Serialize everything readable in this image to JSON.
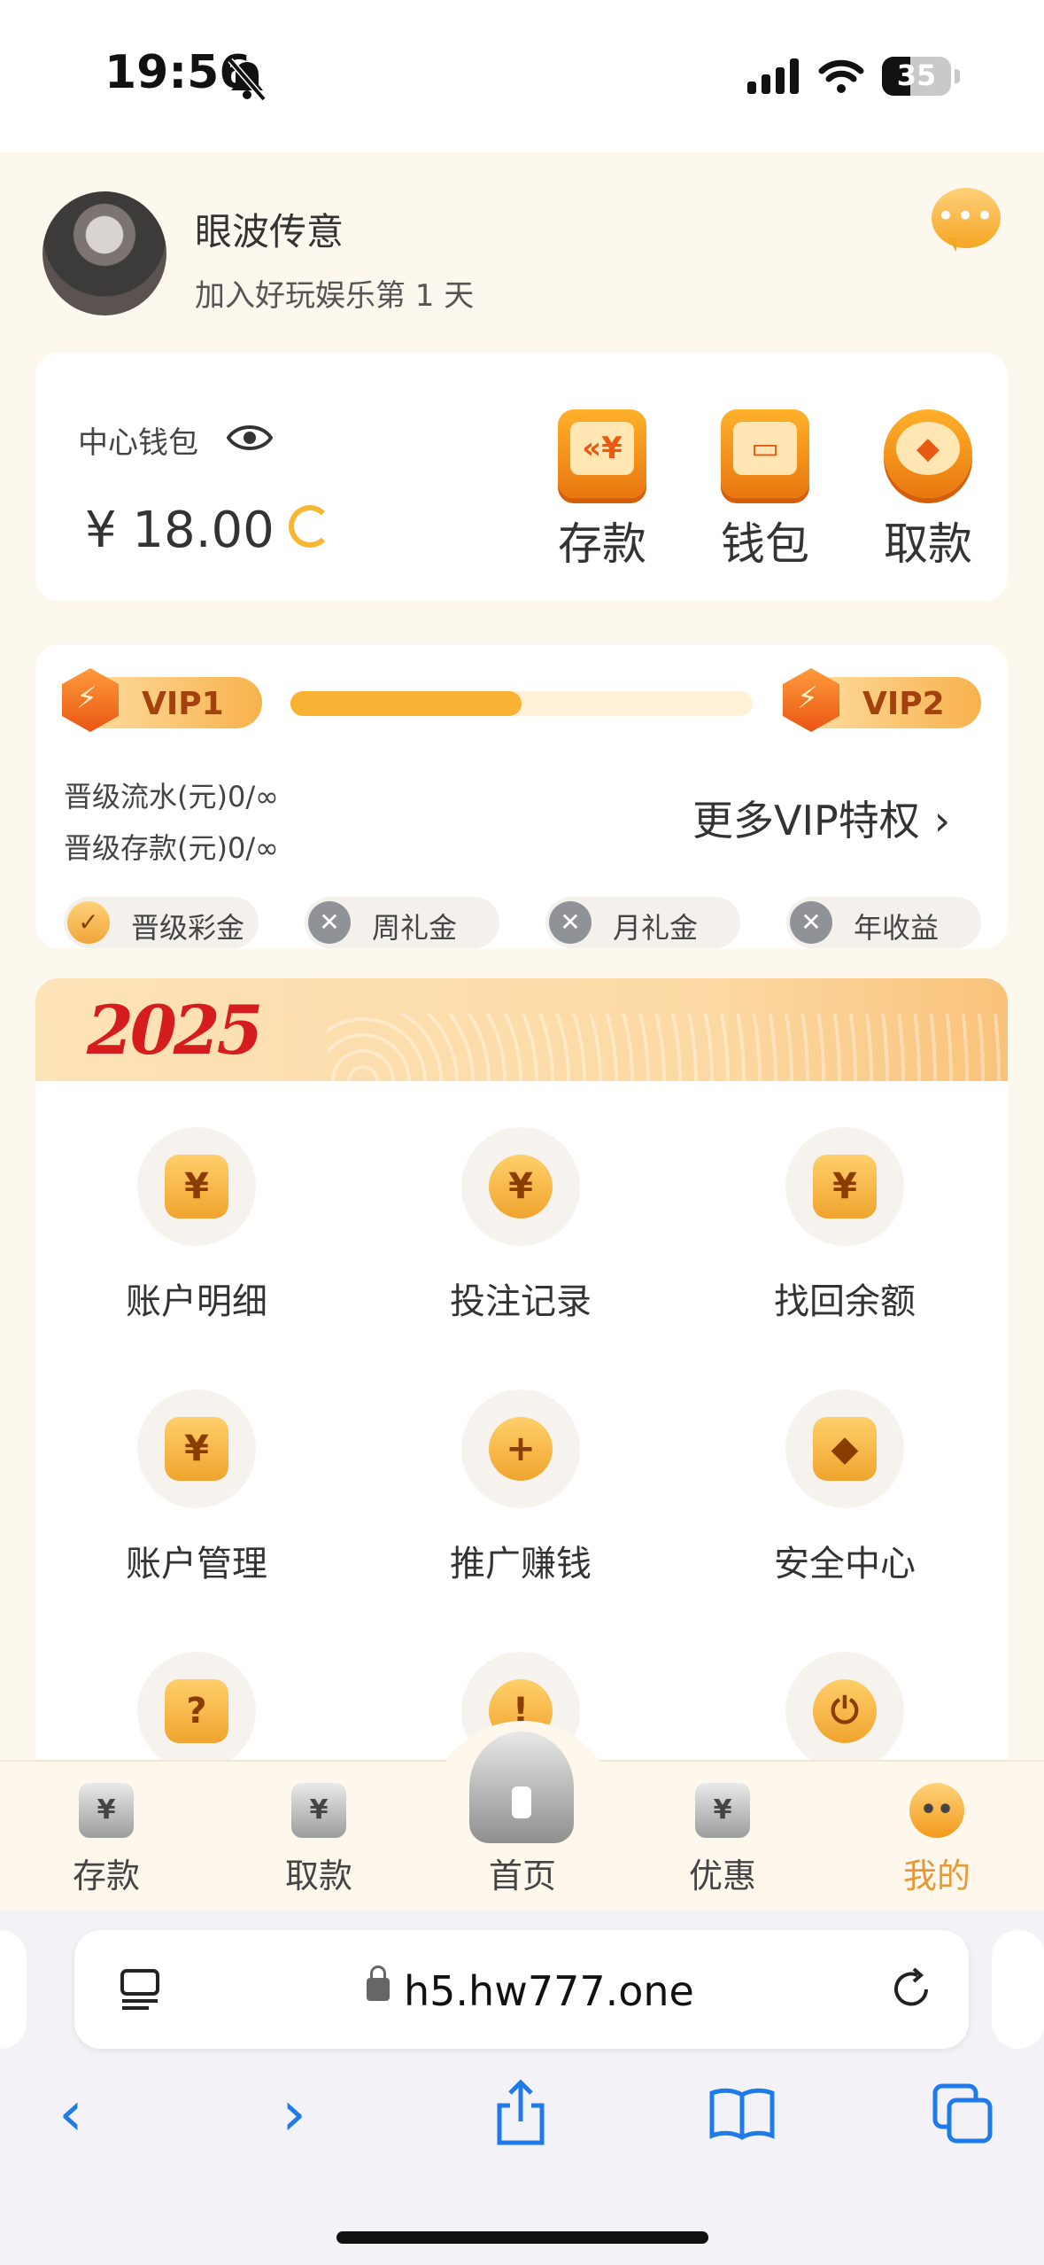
{
  "status_bar": {
    "time": "19:56",
    "battery": "35"
  },
  "profile": {
    "username": "眼波传意",
    "join_text": "加入好玩娱乐第 1 天"
  },
  "wallet": {
    "label": "中心钱包",
    "balance": "¥ 18.00",
    "actions": [
      {
        "label": "存款",
        "icon": "deposit-icon"
      },
      {
        "label": "钱包",
        "icon": "wallet-icon"
      },
      {
        "label": "取款",
        "icon": "withdraw-icon"
      }
    ]
  },
  "vip": {
    "current": "VIP1",
    "next": "VIP2",
    "progress": 0.5,
    "requirements": [
      "晋级流水(元)0/∞",
      "晋级存款(元)0/∞"
    ],
    "more_label": "更多VIP特权",
    "perks": [
      {
        "label": "晋级彩金",
        "enabled": true
      },
      {
        "label": "周礼金",
        "enabled": false
      },
      {
        "label": "月礼金",
        "enabled": false
      },
      {
        "label": "年收益",
        "enabled": false
      }
    ]
  },
  "banner": {
    "logo_text": "2025"
  },
  "menu": [
    {
      "label": "账户明细",
      "icon": "account-detail-icon",
      "glyph": "¥"
    },
    {
      "label": "投注记录",
      "icon": "bet-record-icon",
      "glyph": "¥"
    },
    {
      "label": "找回余额",
      "icon": "recover-balance-icon",
      "glyph": "¥"
    },
    {
      "label": "账户管理",
      "icon": "account-manage-icon",
      "glyph": "¥"
    },
    {
      "label": "推广赚钱",
      "icon": "promote-icon",
      "glyph": "+"
    },
    {
      "label": "安全中心",
      "icon": "security-shield-icon",
      "glyph": "◆"
    },
    {
      "label": "",
      "icon": "help-icon",
      "glyph": "?"
    },
    {
      "label": "",
      "icon": "alert-icon",
      "glyph": "!"
    },
    {
      "label": "",
      "icon": "power-icon",
      "glyph": "⏻"
    }
  ],
  "tabs": [
    {
      "label": "存款",
      "icon": "deposit-tab-icon",
      "glyph": "¥"
    },
    {
      "label": "取款",
      "icon": "withdraw-tab-icon",
      "glyph": "¥"
    },
    {
      "label": "首页",
      "icon": "home-tab-icon",
      "glyph": ""
    },
    {
      "label": "优惠",
      "icon": "promo-tab-icon",
      "glyph": "¥"
    },
    {
      "label": "我的",
      "icon": "mine-tab-icon",
      "glyph": "••"
    }
  ],
  "active_tab": "我的",
  "browser": {
    "url": "h5.hw777.one"
  },
  "colors": {
    "accent": "#f7b733",
    "active_tab": "#e59a3a",
    "link": "#1f7aea"
  }
}
